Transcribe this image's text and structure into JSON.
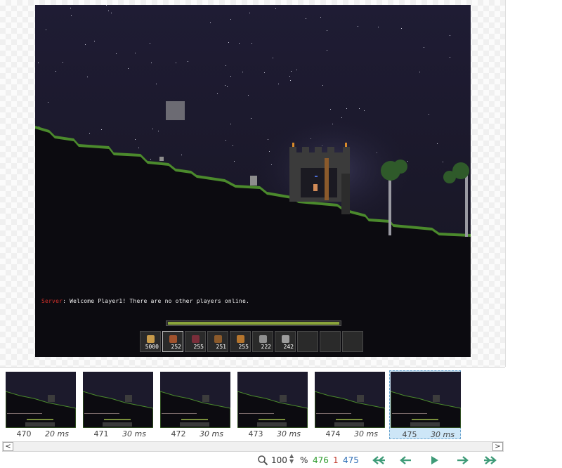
{
  "game": {
    "chat": {
      "sender": "Server",
      "message": ": Welcome Player1! There are no other players online."
    },
    "health_fraction": 1.0,
    "hotbar": [
      {
        "qty": "5000",
        "color": "#c79a4a"
      },
      {
        "qty": "252",
        "color": "#a0522d"
      },
      {
        "qty": "255",
        "color": "#7a2e3a"
      },
      {
        "qty": "251",
        "color": "#8b5a2b"
      },
      {
        "qty": "255",
        "color": "#b5752d"
      },
      {
        "qty": "222",
        "color": "#8f8f8f"
      },
      {
        "qty": "242",
        "color": "#9c9c9c"
      },
      {
        "qty": "",
        "color": ""
      },
      {
        "qty": "",
        "color": ""
      },
      {
        "qty": "",
        "color": ""
      }
    ],
    "active_slot": 1
  },
  "frames": [
    {
      "number": "470",
      "delay": "20 ms"
    },
    {
      "number": "471",
      "delay": "30 ms"
    },
    {
      "number": "472",
      "delay": "30 ms"
    },
    {
      "number": "473",
      "delay": "30 ms"
    },
    {
      "number": "474",
      "delay": "30 ms"
    },
    {
      "number": "475",
      "delay": "30 ms"
    }
  ],
  "selected_frame": 5,
  "scrollbar": {
    "left_arrow": "<",
    "right_arrow": ">"
  },
  "status": {
    "zoom_value": "100",
    "zoom_unit": "%",
    "frame_count_total": "476",
    "frame_count_selected": "1",
    "frame_current": "475"
  },
  "colors": {
    "total": "#2e9b2e",
    "selected": "#c0392b",
    "current": "#2e6db5",
    "nav": "#3f9b78"
  }
}
